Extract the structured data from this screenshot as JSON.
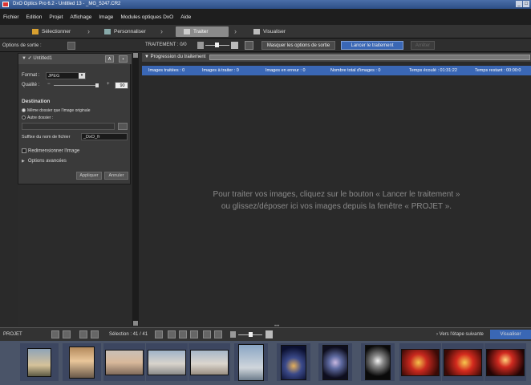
{
  "window": {
    "title": "DxO Optics Pro 6.2 - Untitled 13 - _MG_5247.CR2"
  },
  "menu": [
    "Fichier",
    "Edition",
    "Projet",
    "Affichage",
    "Image",
    "Modules optiques DxO",
    "Aide"
  ],
  "steps": {
    "select": "Sélectionner",
    "customize": "Personnaliser",
    "process": "Traiter",
    "view": "Visualiser"
  },
  "left": {
    "header_label": "Options de sortie :",
    "preset_name": "Untitled1",
    "format_label": "Format :",
    "format_value": "JPEG",
    "quality_label": "Qualité :",
    "quality_value": "90",
    "destination_title": "Destination",
    "dest_same": "Même dossier que l'image originale",
    "dest_other": "Autre dossier :",
    "suffix_label": "Suffixe du nom de fichier",
    "suffix_value": "_DxO_fr",
    "resize_label": "Redimensionner l'image",
    "advanced_label": "Options avancées",
    "apply_button": "Appliquer",
    "cancel_button": "Annuler"
  },
  "toolbar": {
    "processing_label": "TRAITEMENT : 0/0",
    "hide_options_button": "Masquer les options de sortie",
    "launch_button": "Lancer le traitement",
    "stop_button": "Arrêter"
  },
  "progress": {
    "title": "Progression du traitement",
    "stats": {
      "processed": "Images traitées : 0",
      "to_process": "Images à traiter : 0",
      "errors": "Images en erreur : 0",
      "total": "Nombre total d'images : 0",
      "elapsed": "Temps écoulé : 01:31:22",
      "remaining": "Temps restant : 00:00:0"
    }
  },
  "main": {
    "message_line1": "Pour traiter vos images, cliquez sur le bouton « Lancer le traitement »",
    "message_line2": "ou glissez/déposer ici vos images depuis la fenêtre « PROJET »."
  },
  "projectbar": {
    "label": "PROJET",
    "selection": "Sélection : 41 / 41",
    "next_step": "Vers l'étape suivante",
    "view_button": "Visualiser"
  },
  "colors": {
    "accent_blue": "#3a67b5",
    "menu_bg": "#1e1e1e",
    "panel_bg": "#2a2a2a",
    "filmstrip_bg": "#4a5468"
  }
}
